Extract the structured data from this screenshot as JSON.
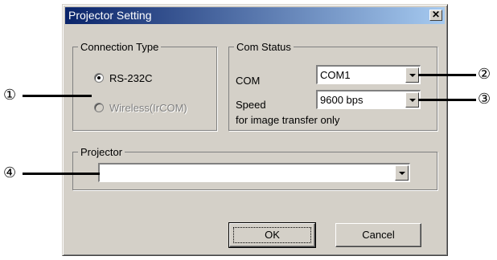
{
  "dialog": {
    "title": "Projector Setting",
    "close_glyph": "✕"
  },
  "connection_type": {
    "legend": "Connection Type",
    "options": [
      {
        "label": "RS-232C",
        "selected": true,
        "enabled": true
      },
      {
        "label": "Wireless(IrCOM)",
        "selected": false,
        "enabled": false
      }
    ]
  },
  "com_status": {
    "legend": "Com Status",
    "com_label": "COM",
    "com_value": "COM1",
    "speed_label": "Speed",
    "speed_value": "9600 bps",
    "note": "for image transfer only"
  },
  "projector": {
    "legend": "Projector",
    "value": ""
  },
  "buttons": {
    "ok": "OK",
    "cancel": "Cancel"
  },
  "callouts": [
    "①",
    "②",
    "③",
    "④"
  ]
}
